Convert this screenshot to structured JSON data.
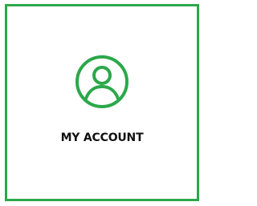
{
  "account_tile": {
    "label": "MY ACCOUNT",
    "icon": "user-circle-icon"
  },
  "colors": {
    "accent": "#2ba84a",
    "text": "#111111",
    "background": "#ffffff"
  }
}
